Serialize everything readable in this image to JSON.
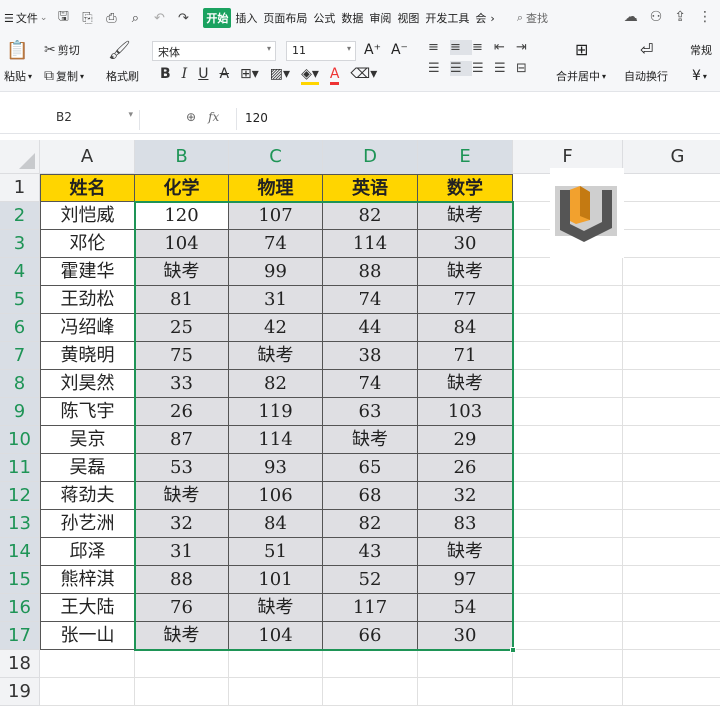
{
  "menubar": {
    "file_label": "文件",
    "tabs": [
      {
        "label": "开始",
        "active": true
      },
      {
        "label": "插入"
      },
      {
        "label": "页面布局"
      },
      {
        "label": "公式"
      },
      {
        "label": "数据"
      },
      {
        "label": "审阅"
      },
      {
        "label": "视图"
      },
      {
        "label": "开发工具"
      },
      {
        "label": "会"
      }
    ],
    "more_glyph": "›",
    "search_label": "查找"
  },
  "ribbon": {
    "paste_label": "粘贴",
    "cut_label": "剪切",
    "copy_label": "复制",
    "format_painter_label": "格式刷",
    "font_name": "宋体",
    "font_size": "11",
    "merge_center_label": "合并居中",
    "wrap_text_label": "自动换行",
    "number_format": "常规",
    "currency_symbol": "¥"
  },
  "formula_bar": {
    "name_box": "B2",
    "formula_value": "120"
  },
  "sheet": {
    "columns": [
      "A",
      "B",
      "C",
      "D",
      "E",
      "F",
      "G"
    ],
    "selected_columns": [
      "B",
      "C",
      "D",
      "E"
    ],
    "rows": [
      "1",
      "2",
      "3",
      "4",
      "5",
      "6",
      "7",
      "8",
      "9",
      "10",
      "11",
      "12",
      "13",
      "14",
      "15",
      "16",
      "17",
      "18",
      "19"
    ],
    "selected_rows": [
      "2",
      "3",
      "4",
      "5",
      "6",
      "7",
      "8",
      "9",
      "10",
      "11",
      "12",
      "13",
      "14",
      "15",
      "16",
      "17"
    ],
    "table_header": [
      "姓名",
      "化学",
      "物理",
      "英语",
      "数学"
    ],
    "table_rows": [
      [
        "刘恺威",
        "120",
        "107",
        "82",
        "缺考"
      ],
      [
        "邓伦",
        "104",
        "74",
        "114",
        "30"
      ],
      [
        "霍建华",
        "缺考",
        "99",
        "88",
        "缺考"
      ],
      [
        "王劲松",
        "81",
        "31",
        "74",
        "77"
      ],
      [
        "冯绍峰",
        "25",
        "42",
        "44",
        "84"
      ],
      [
        "黄晓明",
        "75",
        "缺考",
        "38",
        "71"
      ],
      [
        "刘昊然",
        "33",
        "82",
        "74",
        "缺考"
      ],
      [
        "陈飞宇",
        "26",
        "119",
        "63",
        "103"
      ],
      [
        "吴京",
        "87",
        "114",
        "缺考",
        "29"
      ],
      [
        "吴磊",
        "53",
        "93",
        "65",
        "26"
      ],
      [
        "蒋劲夫",
        "缺考",
        "106",
        "68",
        "32"
      ],
      [
        "孙艺洲",
        "32",
        "84",
        "82",
        "83"
      ],
      [
        "邱泽",
        "31",
        "51",
        "43",
        "缺考"
      ],
      [
        "熊梓淇",
        "88",
        "101",
        "52",
        "97"
      ],
      [
        "王大陆",
        "76",
        "缺考",
        "117",
        "54"
      ],
      [
        "张一山",
        "缺考",
        "104",
        "66",
        "30"
      ]
    ],
    "active_cell": "B2"
  },
  "colors": {
    "accent": "#1e9456",
    "header_fill": "#ffd500",
    "selection_fill": "#dfdfe3"
  }
}
